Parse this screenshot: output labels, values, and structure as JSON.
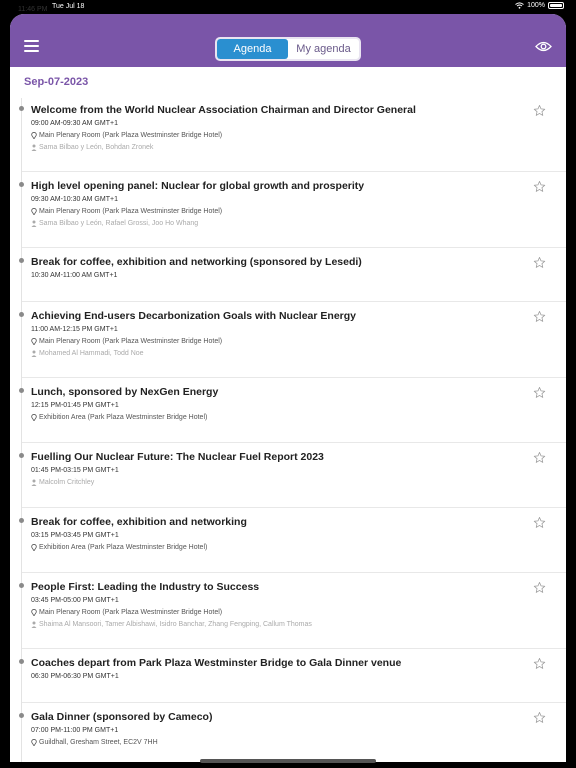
{
  "status": {
    "time": "11:46 PM",
    "date": "Tue Jul 18",
    "battery": "100%"
  },
  "nav": {
    "tabs": [
      {
        "label": "Agenda",
        "active": true
      },
      {
        "label": "My agenda",
        "active": false
      }
    ],
    "colors": {
      "bar": "#7a55a8",
      "active_tab": "#2a8fd0"
    }
  },
  "date_header": "Sep-07-2023",
  "sessions": [
    {
      "title": "Welcome from the World Nuclear Association Chairman and Director General",
      "time": "09:00 AM-09:30 AM GMT+1",
      "location": "Main Plenary Room (Park Plaza Westminster Bridge Hotel)",
      "speakers": "Sama Bilbao y León, Bohdan Zronek"
    },
    {
      "title": "High level opening panel: Nuclear for global growth and prosperity",
      "time": "09:30 AM-10:30 AM GMT+1",
      "location": "Main Plenary Room (Park Plaza Westminster Bridge Hotel)",
      "speakers": "Sama Bilbao y León, Rafael Grossi, Joo Ho Whang"
    },
    {
      "title": "Break for coffee, exhibition and networking (sponsored by Lesedi)",
      "time": "10:30 AM-11:00 AM GMT+1",
      "location": "",
      "speakers": ""
    },
    {
      "title": "Achieving End-users  Decarbonization Goals with Nuclear Energy",
      "time": "11:00 AM-12:15 PM GMT+1",
      "location": "Main Plenary Room (Park Plaza Westminster Bridge Hotel)",
      "speakers": "Mohamed Al Hammadi, Todd Noe"
    },
    {
      "title": "Lunch, sponsored by NexGen Energy",
      "time": "12:15 PM-01:45 PM GMT+1",
      "location": "Exhibition Area (Park Plaza Westminster Bridge Hotel)",
      "speakers": ""
    },
    {
      "title": "Fuelling Our Nuclear Future: The Nuclear Fuel Report 2023",
      "time": "01:45 PM-03:15 PM GMT+1",
      "location": "",
      "speakers": "Malcolm Critchley"
    },
    {
      "title": "Break for coffee, exhibition and networking",
      "time": "03:15 PM-03:45 PM GMT+1",
      "location": "Exhibition Area (Park Plaza Westminster Bridge Hotel)",
      "speakers": ""
    },
    {
      "title": "People First: Leading the Industry to Success",
      "time": "03:45 PM-05:00 PM GMT+1",
      "location": "Main Plenary Room (Park Plaza Westminster Bridge Hotel)",
      "speakers": "Shaima Al Mansoori, Tamer Albishawi, Isidro Banchar, Zhang Fengping, Callum Thomas"
    },
    {
      "title": "Coaches depart from Park Plaza Westminster Bridge to Gala Dinner venue",
      "time": "06:30 PM-06:30 PM GMT+1",
      "location": "",
      "speakers": ""
    },
    {
      "title": "Gala Dinner (sponsored by Cameco)",
      "time": "07:00 PM-11:00 PM GMT+1",
      "location": "Guildhall, Gresham Street, EC2V 7HH",
      "speakers": ""
    }
  ]
}
